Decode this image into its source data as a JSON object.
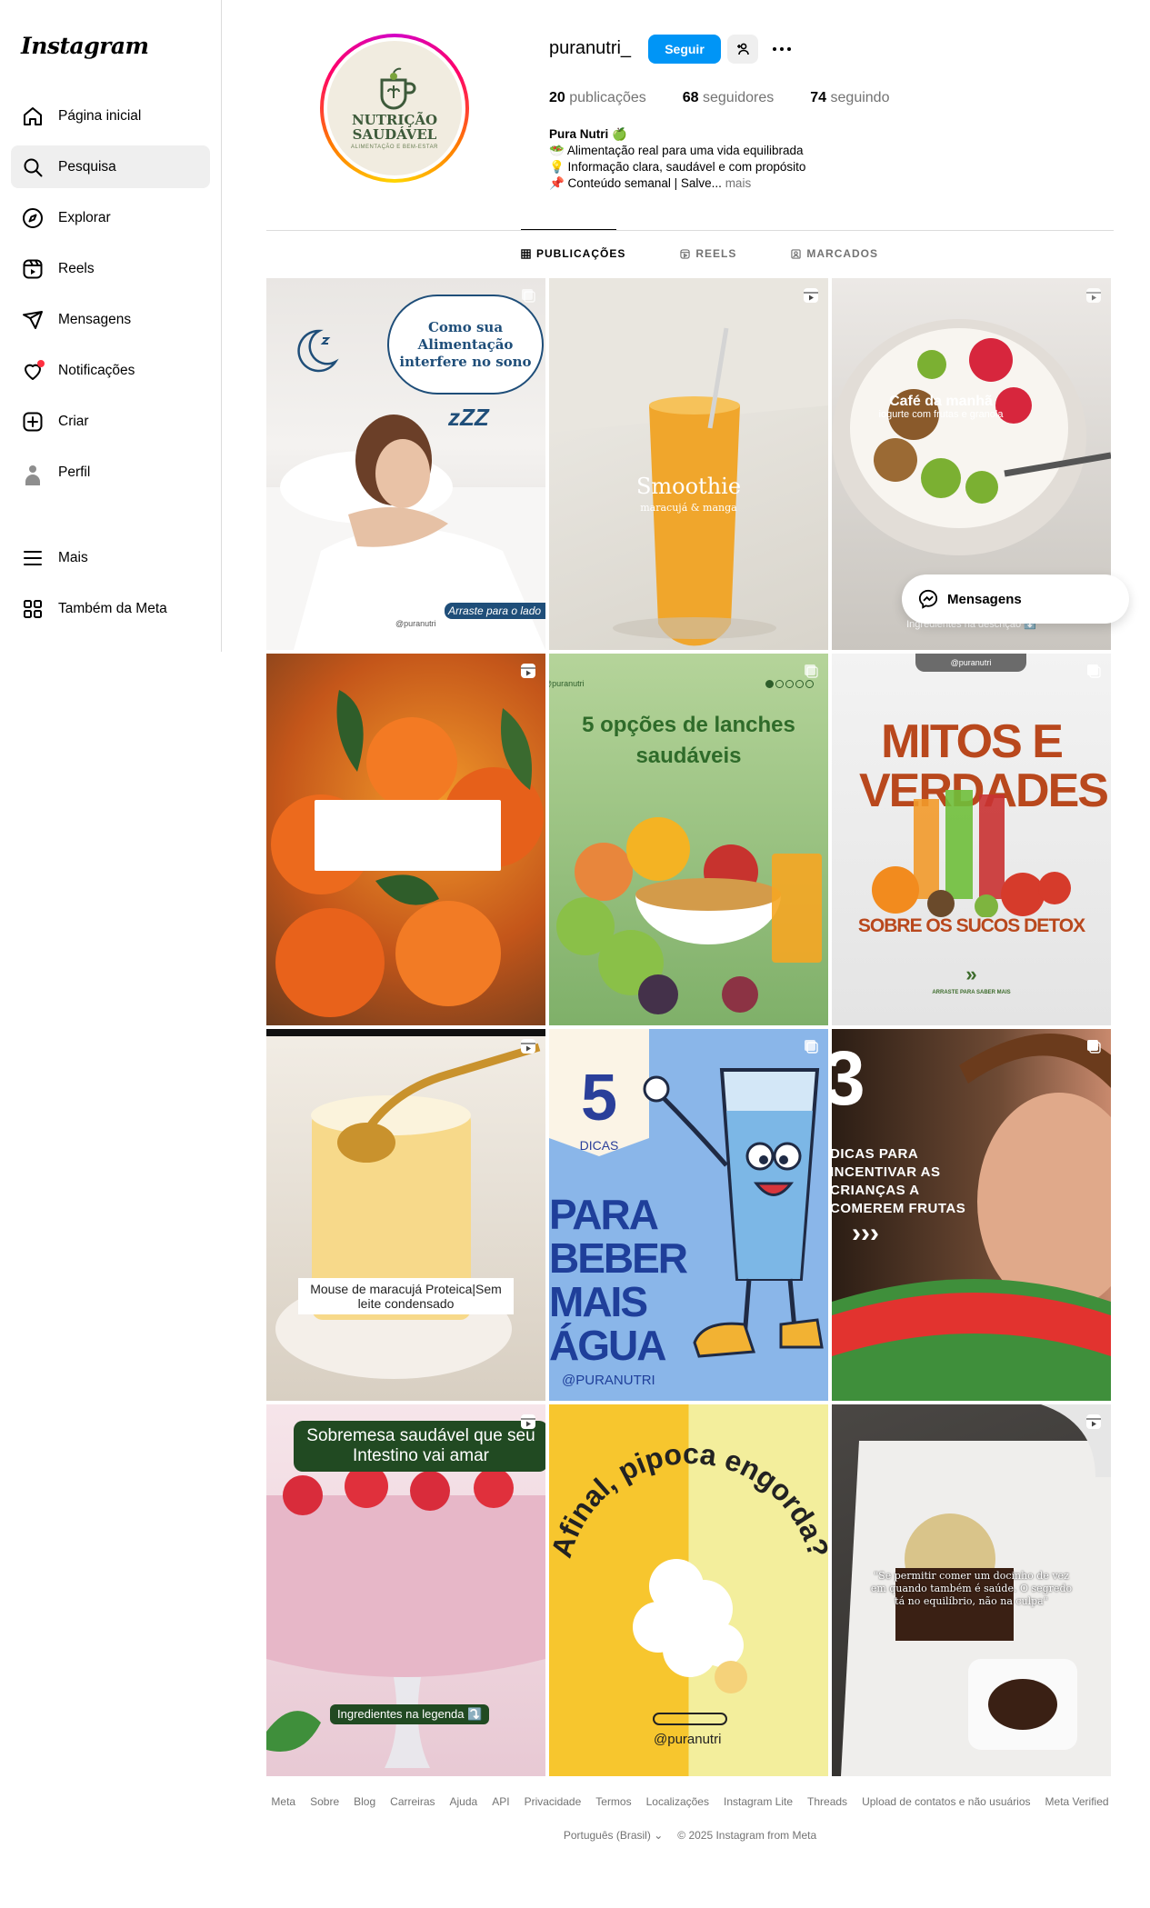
{
  "sidebar": {
    "logo": "Instagram",
    "items": [
      {
        "label": "Página inicial",
        "icon": "home-icon"
      },
      {
        "label": "Pesquisa",
        "icon": "search-icon"
      },
      {
        "label": "Explorar",
        "icon": "explore-icon"
      },
      {
        "label": "Reels",
        "icon": "reels-icon"
      },
      {
        "label": "Mensagens",
        "icon": "messages-icon"
      },
      {
        "label": "Notificações",
        "icon": "heart-icon"
      },
      {
        "label": "Criar",
        "icon": "create-icon"
      },
      {
        "label": "Perfil",
        "icon": "avatar-icon"
      }
    ],
    "bottom_items": [
      {
        "label": "Mais",
        "icon": "menu-icon"
      },
      {
        "label": "Também da Meta",
        "icon": "meta-apps-icon"
      }
    ]
  },
  "profile": {
    "username": "puranutri_",
    "follow_label": "Seguir",
    "avatar_text_1": "NUTRIÇÃO",
    "avatar_text_2": "SAUDÁVEL",
    "avatar_text_3": "ALIMENTAÇÃO E BEM-ESTAR",
    "stats": {
      "posts_count": "20",
      "posts_label": "publicações",
      "followers_count": "68",
      "followers_label": "seguidores",
      "following_count": "74",
      "following_label": "seguindo"
    },
    "bio": {
      "name": "Pura Nutri 🍏",
      "line1": "🥗 Alimentação real para uma vida equilibrada",
      "line2": "💡 Informação clara, saudável e com propósito",
      "line3": "📌 Conteúdo semanal | Salve...",
      "more": "mais"
    }
  },
  "tabs": [
    {
      "label": "PUBLICAÇÕES"
    },
    {
      "label": "REELS"
    },
    {
      "label": "MARCADOS"
    }
  ],
  "posts": {
    "p1": {
      "title": "Como sua Alimentação interfere no sono",
      "zzz": "zZZ",
      "swipe": "Arraste para o lado",
      "handle": "@puranutri"
    },
    "p2": {
      "title": "Smoothie",
      "subtitle": "maracujá & manga"
    },
    "p3": {
      "title": "Café da manhã",
      "subtitle": "iogurte com frutas e granola",
      "footer": "Ingredientes na descrição ⬇️"
    },
    "p5": {
      "handle": "@puranutri",
      "title": "5 opções de lanches saudáveis"
    },
    "p6": {
      "handle": "@puranutri",
      "title": "MITOS E VERDADES",
      "subtitle": "SOBRE OS SUCOS DETOX",
      "swipe": "ARRASTE PARA SABER MAIS",
      "arrows": "»"
    },
    "p7": {
      "caption": "Mouse de maracujá Proteica|Sem leite condensado"
    },
    "p8": {
      "number": "5",
      "dicas": "DICAS",
      "title_1": "PARA",
      "title_2": "BEBER",
      "title_3": "MAIS",
      "title_4": "ÁGUA",
      "handle": "@PURANUTRI"
    },
    "p9": {
      "number": "3",
      "text": "DICAS PARA INCENTIVAR AS CRIANÇAS A COMEREM FRUTAS",
      "arrows": "›››"
    },
    "p10": {
      "title": "Sobremesa saudável que seu Intestino vai amar",
      "footer": "Ingredientes na legenda ⤵️"
    },
    "p11": {
      "title": "Afinal, pipoca engorda?",
      "handle": "@puranutri"
    },
    "p12": {
      "quote": "\"Se permitir comer um docinho de vez em quando também é saúde. O segredo tá no equilíbrio, não na culpa\""
    }
  },
  "messages_bubble": {
    "label": "Mensagens"
  },
  "footer": {
    "links": [
      "Meta",
      "Sobre",
      "Blog",
      "Carreiras",
      "Ajuda",
      "API",
      "Privacidade",
      "Termos",
      "Localizações",
      "Instagram Lite",
      "Threads",
      "Upload de contatos e não usuários",
      "Meta Verified"
    ],
    "language": "Português (Brasil)",
    "copyright": "© 2025 Instagram from Meta"
  },
  "colors": {
    "accent": "#0095f6",
    "border": "#dbdbdb",
    "muted": "#737373",
    "notification": "#ff3040"
  }
}
